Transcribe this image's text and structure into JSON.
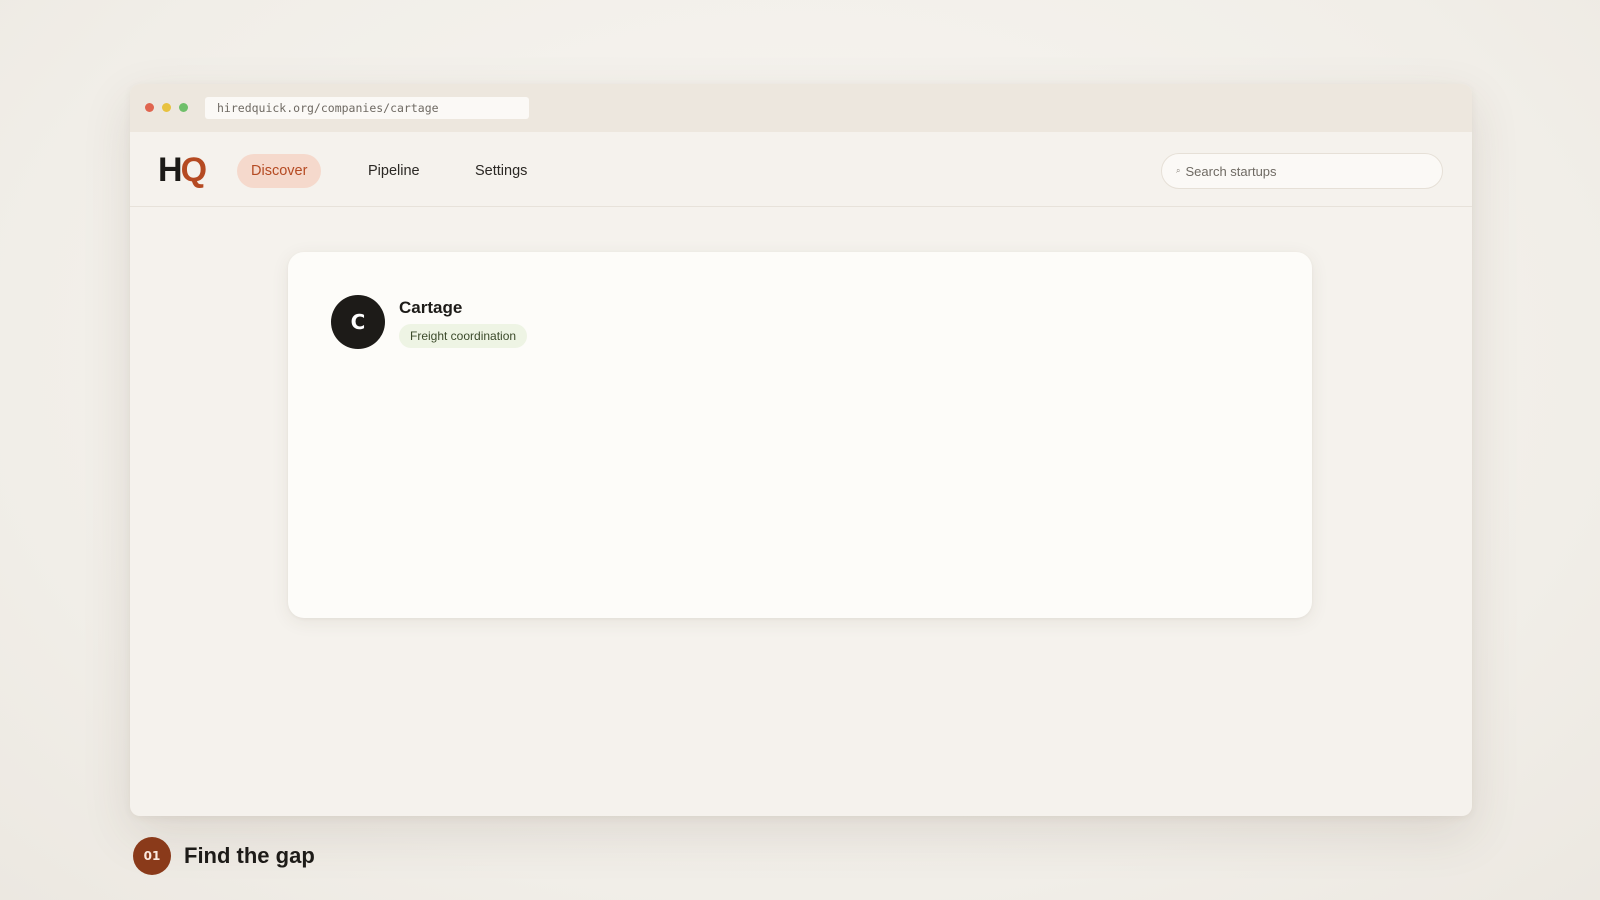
{
  "browser": {
    "url": "hiredquick.org/companies/cartage",
    "window_controls": {
      "close_color": "#e0654f",
      "minimize_color": "#e8c23f",
      "maximize_color": "#6fbf6a"
    }
  },
  "app": {
    "logo": {
      "h": "H",
      "q": "Q"
    },
    "nav": [
      {
        "label": "Discover",
        "active": true
      },
      {
        "label": "Pipeline",
        "active": false
      },
      {
        "label": "Settings",
        "active": false
      }
    ],
    "search": {
      "placeholder": "Search startups",
      "icon": "search-icon"
    }
  },
  "company": {
    "avatar_letter": "C",
    "name": "Cartage",
    "tag": "Freight coordination"
  },
  "step": {
    "number": "01",
    "label": "Find the gap"
  },
  "colors": {
    "accent": "#b54a22",
    "accent_soft": "#f5d9cc",
    "tag_bg": "#eef4e4",
    "step_badge": "#8a3a1a"
  }
}
